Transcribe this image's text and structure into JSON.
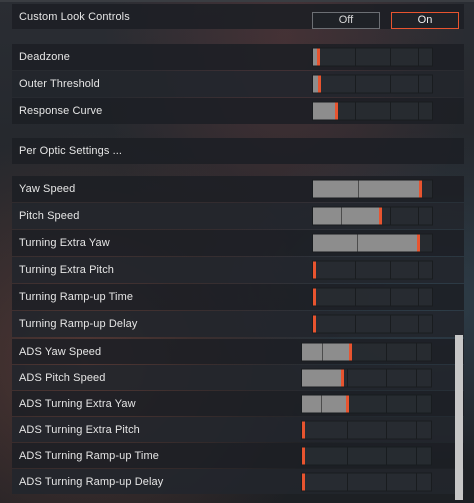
{
  "custom_look": {
    "label": "Custom Look Controls",
    "off_label": "Off",
    "on_label": "On",
    "selected": "On"
  },
  "section_1": [
    {
      "label": "Deadzone",
      "value_fraction": 0.04
    },
    {
      "label": "Outer Threshold",
      "value_fraction": 0.05
    },
    {
      "label": "Response Curve",
      "value_fraction": 0.19
    }
  ],
  "per_optic": {
    "label": "Per Optic Settings ..."
  },
  "section_2": [
    {
      "label": "Yaw Speed",
      "value_fraction": 0.9
    },
    {
      "label": "Pitch Speed",
      "value_fraction": 0.56
    },
    {
      "label": "Turning Extra Yaw",
      "value_fraction": 0.88
    },
    {
      "label": "Turning Extra Pitch",
      "value_fraction": 0.0
    },
    {
      "label": "Turning Ramp-up Time",
      "value_fraction": 0.0
    },
    {
      "label": "Turning Ramp-up Delay",
      "value_fraction": 0.0
    }
  ],
  "section_3": [
    {
      "label": "ADS Yaw Speed",
      "value_fraction": 0.37
    },
    {
      "label": "ADS Pitch Speed",
      "value_fraction": 0.31
    },
    {
      "label": "ADS Turning Extra Yaw",
      "value_fraction": 0.35
    },
    {
      "label": "ADS Turning Extra Pitch",
      "value_fraction": 0.0
    },
    {
      "label": "ADS Turning Ramp-up Time",
      "value_fraction": 0.0
    },
    {
      "label": "ADS Turning Ramp-up Delay",
      "value_fraction": 0.0
    }
  ],
  "colors": {
    "accent": "#e8542f",
    "fill": "#8d8d8d"
  }
}
